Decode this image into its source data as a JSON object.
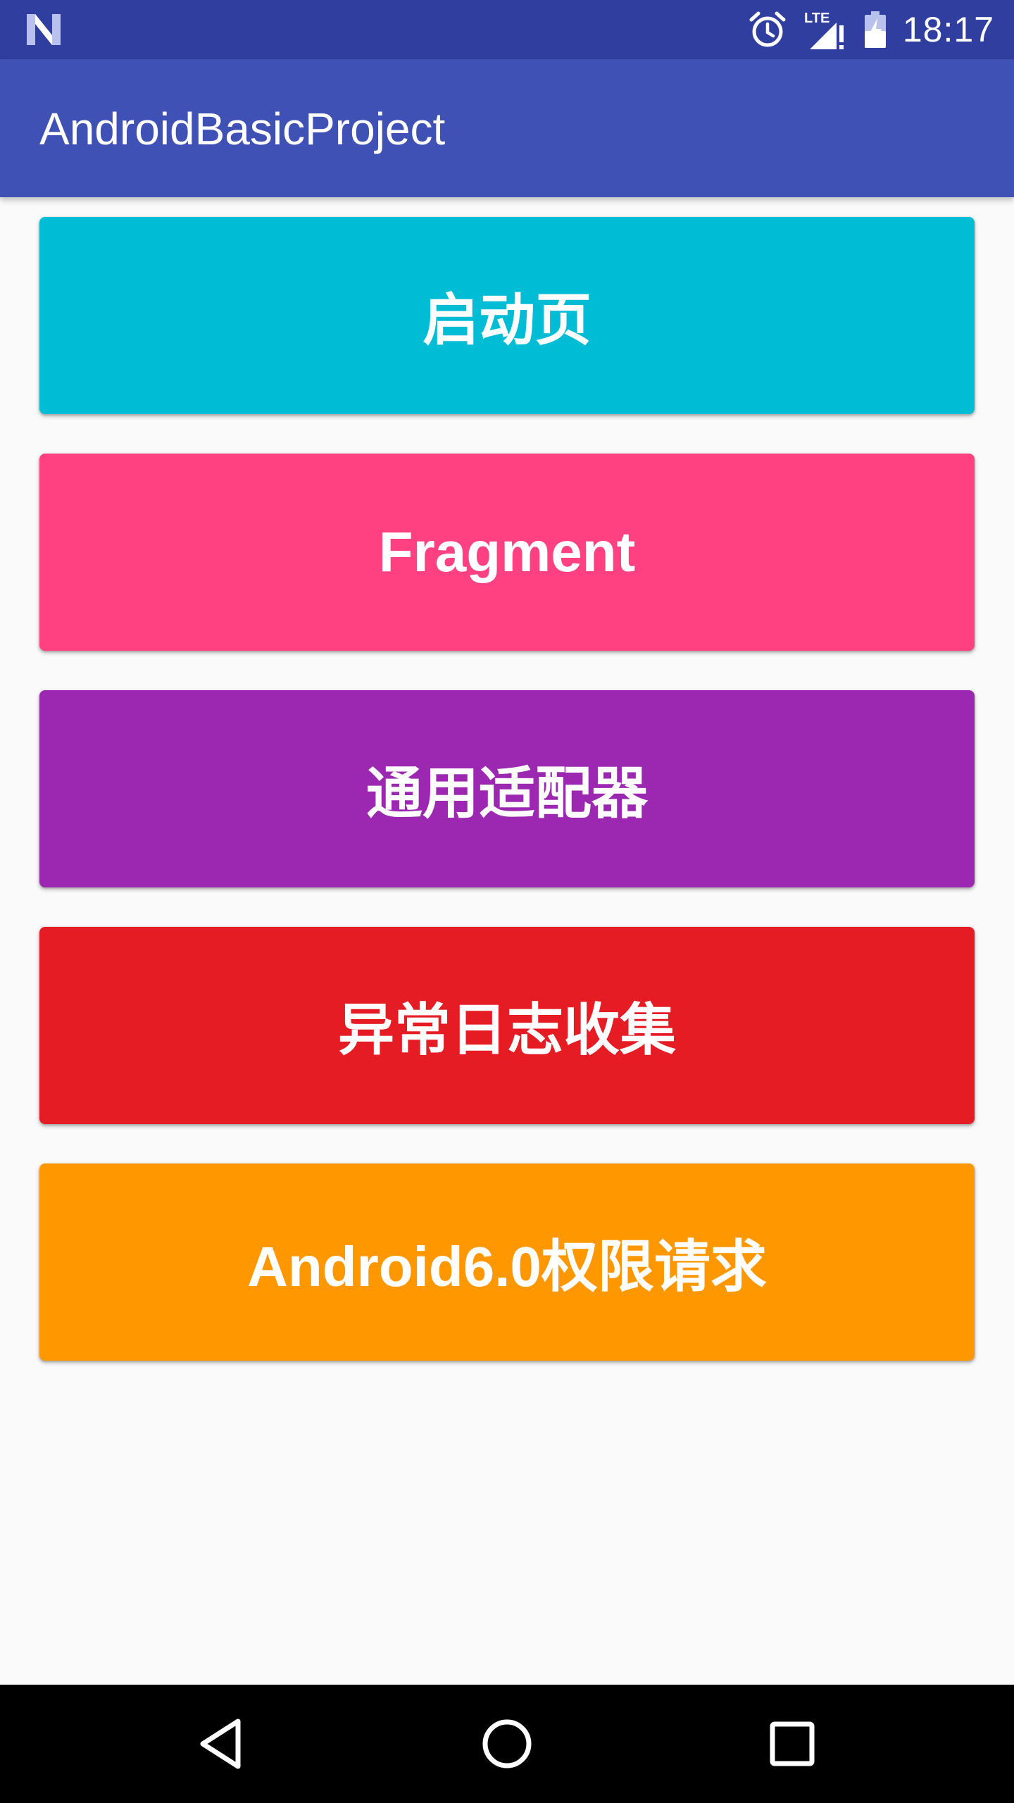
{
  "status_bar": {
    "time": "18:17",
    "left_icon": "n-notification-icon",
    "icons": [
      "alarm-icon",
      "lte-signal-icon",
      "battery-charging-icon"
    ],
    "network_label": "LTE",
    "background": "#303f9f"
  },
  "app_bar": {
    "title": "AndroidBasicProject",
    "background": "#3f51b5"
  },
  "buttons": [
    {
      "label": "启动页",
      "color": "#00bcd4"
    },
    {
      "label": "Fragment",
      "color": "#ff4081"
    },
    {
      "label": "通用适配器",
      "color": "#9c27b0"
    },
    {
      "label": "异常日志收集",
      "color": "#e61c24"
    },
    {
      "label": "Android6.0权限请求",
      "color": "#ff9800"
    }
  ],
  "nav_bar": {
    "icons": [
      "back-icon",
      "home-icon",
      "recents-icon"
    ]
  }
}
